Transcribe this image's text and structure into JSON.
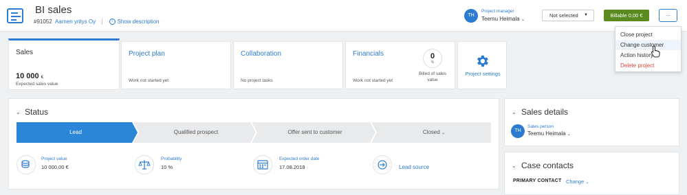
{
  "header": {
    "title": "BI sales",
    "project_number": "#91052",
    "company": "Aarnen yritys Oy",
    "show_description": "Show description",
    "manager_label": "Project manager",
    "manager_name": "Teemu Heimala",
    "manager_initials": "TH",
    "select_value": "Not selected",
    "billable_label": "Billable 0,00 €",
    "more_label": "..."
  },
  "menu": {
    "items": [
      "Close project",
      "Change customer",
      "Action history",
      "Delete project"
    ]
  },
  "cards": {
    "sales": {
      "title": "Sales",
      "value": "10 000",
      "currency": "€",
      "sub": "Expected sales value"
    },
    "plan": {
      "title": "Project plan",
      "sub": "Work not started yet"
    },
    "collab": {
      "title": "Collaboration",
      "sub": "No project tasks"
    },
    "financials": {
      "title": "Financials",
      "sub": "Work not started yet",
      "billed_value": "0",
      "billed_pct": "%",
      "billed_label": "Billed of sales value"
    },
    "settings": {
      "label": "Project settings"
    }
  },
  "status": {
    "title": "Status",
    "stages": [
      "Lead",
      "Qualified prospect",
      "Offer sent to customer",
      "Closed"
    ],
    "project_value_label": "Project value",
    "project_value": "10 000,00 €",
    "probability_label": "Probability",
    "probability": "10 %",
    "expected_date_label": "Expected order date",
    "expected_date": "17.08.2018",
    "lead_source": "Lead source"
  },
  "sales_details": {
    "title": "Sales details",
    "person_label": "Sales person",
    "person_name": "Teemu Heimala",
    "person_initials": "TH"
  },
  "case_contacts": {
    "title": "Case contacts",
    "primary_label": "PRIMARY CONTACT",
    "change_label": "Change"
  },
  "colors": {
    "accent": "#2b7bd1",
    "billable": "#5b8a1e",
    "danger": "#d64545"
  }
}
